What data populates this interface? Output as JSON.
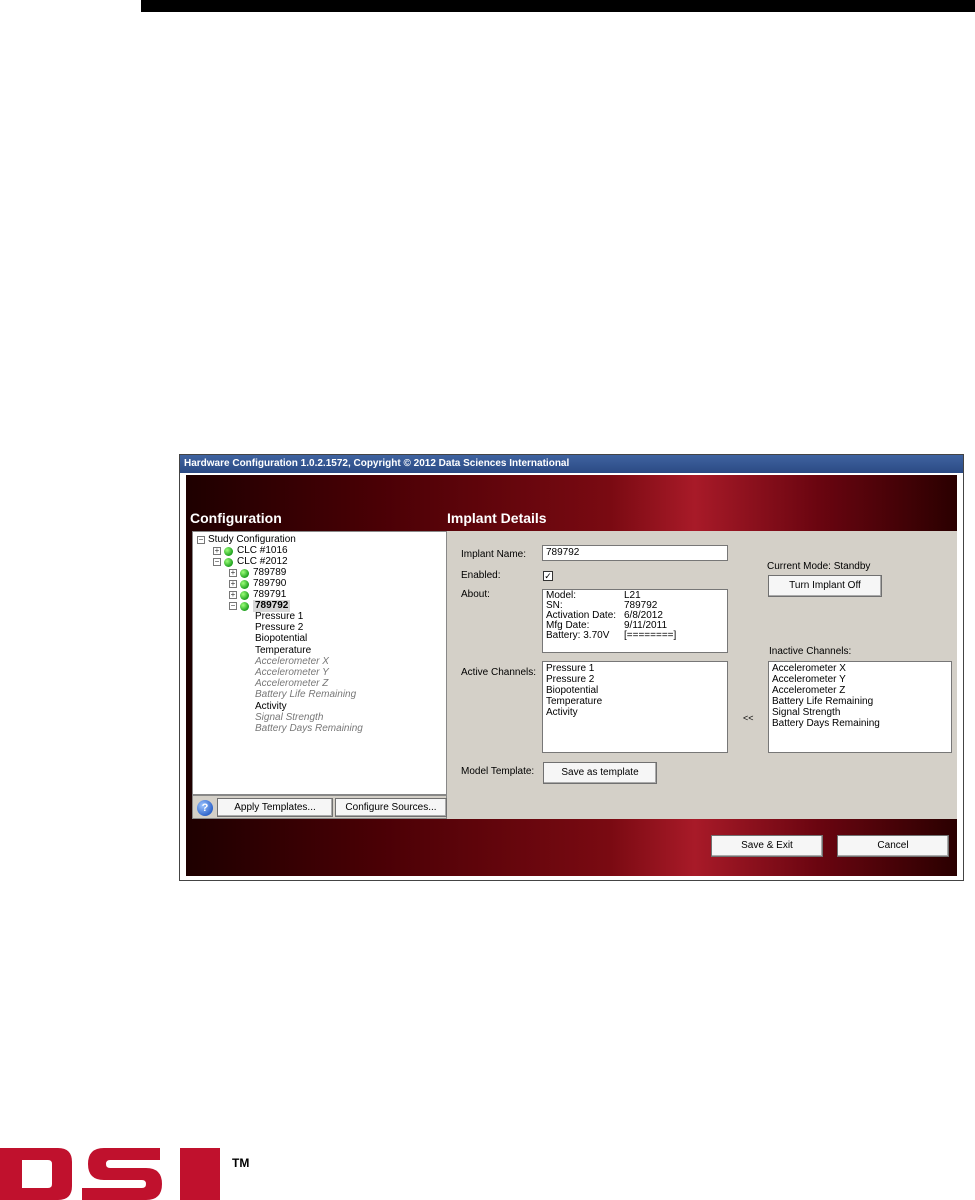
{
  "window": {
    "title": "Hardware Configuration 1.0.2.1572, Copyright © 2012 Data Sciences International"
  },
  "configuration": {
    "heading": "Configuration",
    "tree": {
      "root": "Study Configuration",
      "clc1": "CLC #1016",
      "clc2": "CLC #2012",
      "implants": [
        "789789",
        "789790",
        "789791",
        "789792"
      ],
      "channels": [
        {
          "label": "Pressure 1",
          "active": true
        },
        {
          "label": "Pressure 2",
          "active": true
        },
        {
          "label": "Biopotential",
          "active": true
        },
        {
          "label": "Temperature",
          "active": true
        },
        {
          "label": "Accelerometer X",
          "active": false
        },
        {
          "label": "Accelerometer Y",
          "active": false
        },
        {
          "label": "Accelerometer Z",
          "active": false
        },
        {
          "label": "Battery Life Remaining",
          "active": false
        },
        {
          "label": "Activity",
          "active": true
        },
        {
          "label": "Signal Strength",
          "active": false
        },
        {
          "label": "Battery Days Remaining",
          "active": false
        }
      ]
    },
    "apply_templates_label": "Apply Templates...",
    "configure_sources_label": "Configure Sources...",
    "help_symbol": "?"
  },
  "implant_details": {
    "heading": "Implant Details",
    "implant_name_label": "Implant Name:",
    "implant_name_value": "789792",
    "enabled_label": "Enabled:",
    "enabled_checked": true,
    "enabled_mark": "✓",
    "about_label": "About:",
    "about": [
      {
        "key": "Model:",
        "value": "L21"
      },
      {
        "key": "SN:",
        "value": "789792"
      },
      {
        "key": "Activation Date:",
        "value": "6/8/2012"
      },
      {
        "key": "Mfg Date:",
        "value": "9/11/2011"
      },
      {
        "key": "Battery: 3.70V",
        "value": "[========]"
      }
    ],
    "current_mode_label": "Current Mode: Standby",
    "turn_off_label": "Turn Implant Off",
    "active_channels_label": "Active Channels:",
    "active_channels": [
      "Pressure 1",
      "Pressure 2",
      "Biopotential",
      "Temperature",
      "Activity"
    ],
    "move_arrow": "<<",
    "inactive_channels_label": "Inactive Channels:",
    "inactive_channels": [
      "Accelerometer X",
      "Accelerometer Y",
      "Accelerometer Z",
      "Battery Life Remaining",
      "Signal Strength",
      "Battery Days Remaining"
    ],
    "model_template_label": "Model Template:",
    "save_template_label": "Save as template"
  },
  "footer": {
    "save_exit_label": "Save & Exit",
    "cancel_label": "Cancel"
  },
  "brand": {
    "logo_text": "DSI",
    "trademark": "TM",
    "logo_color": "#c0112d"
  }
}
